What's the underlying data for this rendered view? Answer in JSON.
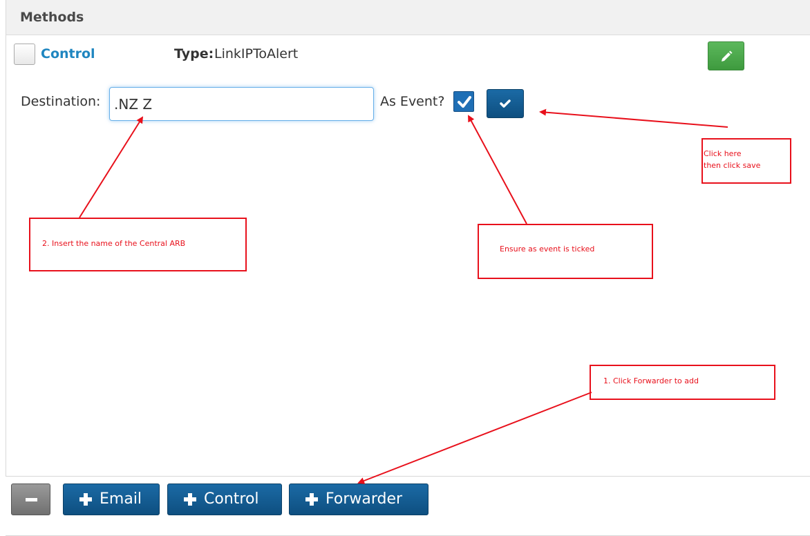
{
  "panel": {
    "title": "Methods"
  },
  "method": {
    "name": "Control",
    "type_label": "Type:",
    "type_value": "LinkIPToAlert"
  },
  "form": {
    "destination_label": "Destination:",
    "destination_value": ".NZ Z",
    "as_event_label": "As Event?",
    "as_event_checked": true
  },
  "toolbar": {
    "remove_icon": "minus-icon",
    "email_label": "Email",
    "control_label": "Control",
    "forwarder_label": "Forwarder"
  },
  "annotations": {
    "save_note_line1": "Click here",
    "save_note_line2": "then click save",
    "destination_note": "2. Insert the name of the Central ARB",
    "event_note": "Ensure as event is ticked",
    "forwarder_note": "1. Click Forwarder to add"
  },
  "colors": {
    "primary_button": "#155d94",
    "edit_button": "#4cae4c",
    "link": "#1f86c0",
    "annotation": "#e8101b"
  }
}
